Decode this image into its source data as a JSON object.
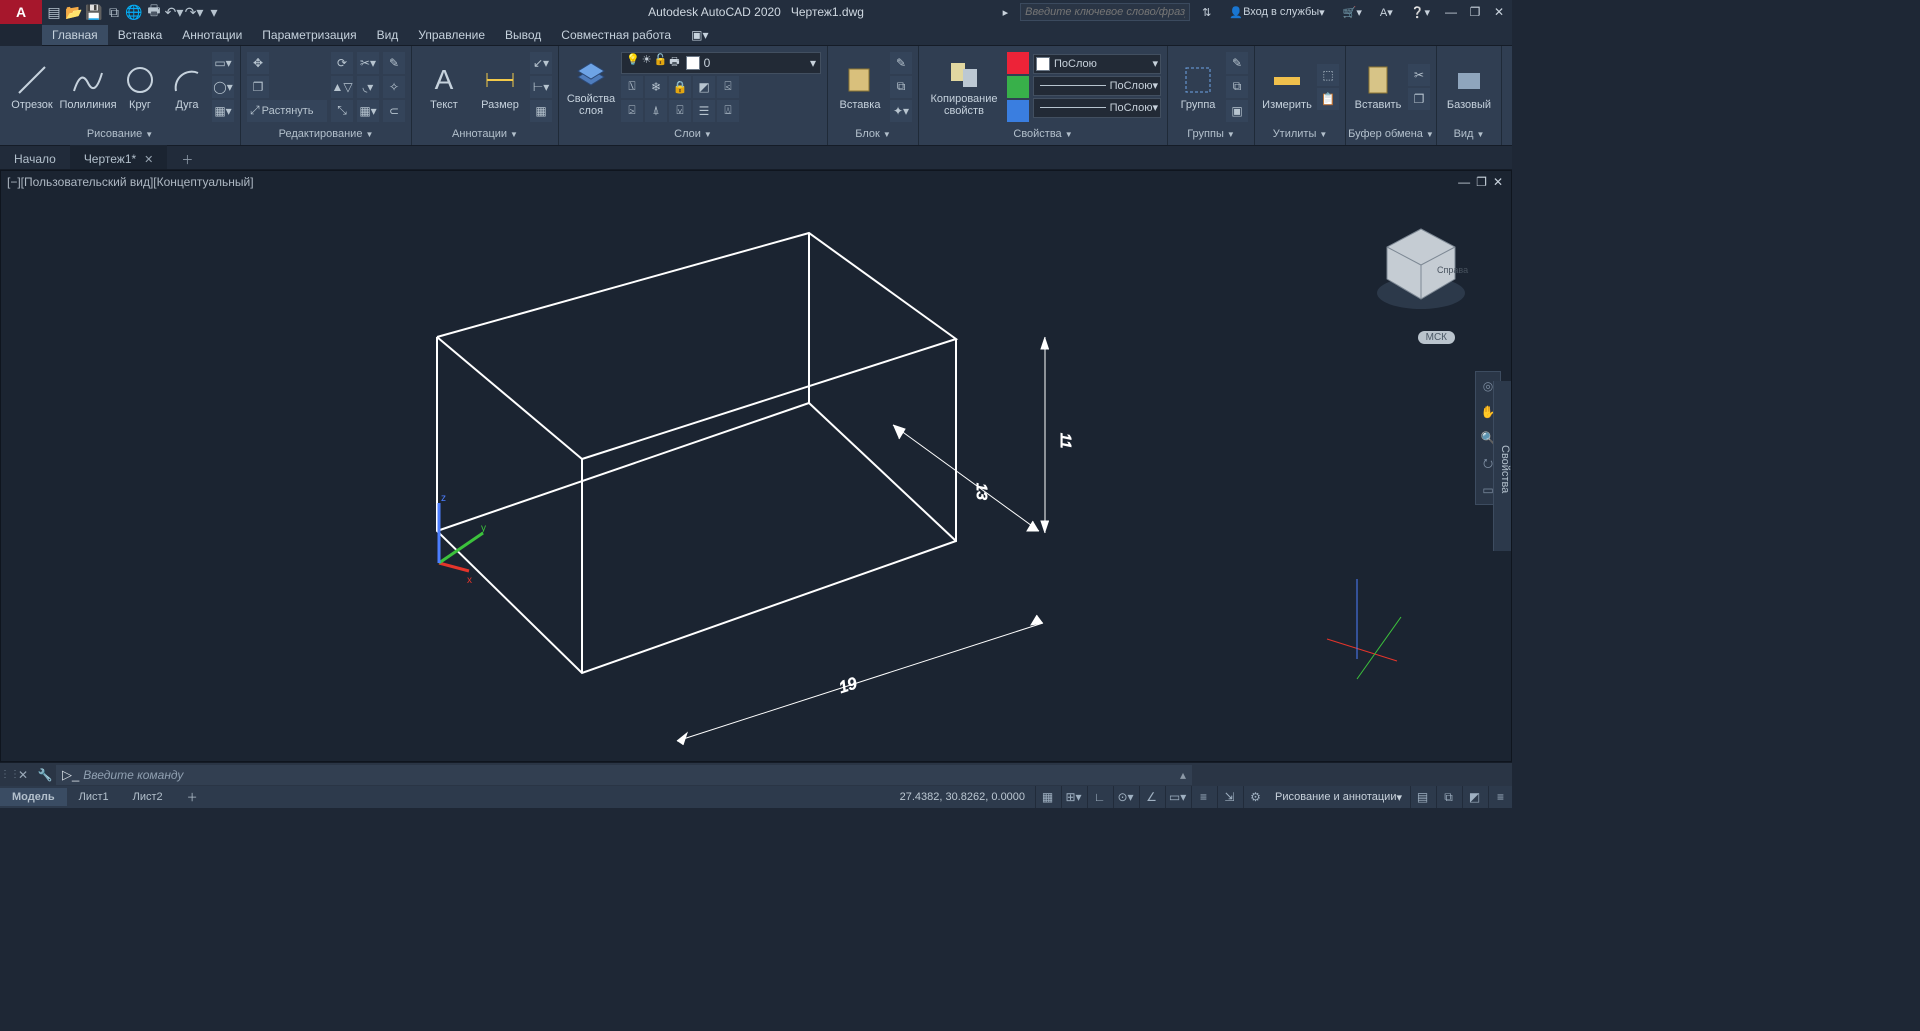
{
  "title": {
    "app": "Autodesk AutoCAD 2020",
    "file": "Чертеж1.dwg"
  },
  "search_placeholder": "Введите ключевое слово/фразу",
  "signin": "Вход в службы",
  "ribbon_tabs": [
    "Главная",
    "Вставка",
    "Аннотации",
    "Параметризация",
    "Вид",
    "Управление",
    "Вывод",
    "Совместная работа"
  ],
  "draw": {
    "line": "Отрезок",
    "pline": "Полилиния",
    "circle": "Круг",
    "arc": "Дуга",
    "title": "Рисование"
  },
  "mod": {
    "stretch": "Растянуть",
    "title": "Редактирование"
  },
  "annot": {
    "text": "Текст",
    "dim": "Размер",
    "title": "Аннотации"
  },
  "layers": {
    "props": "Свойства\nслоя",
    "current": "0",
    "title": "Слои"
  },
  "block": {
    "insert": "Вставка",
    "title": "Блок"
  },
  "props": {
    "match": "Копирование\nсвойств",
    "bylayer": "ПоСлою",
    "title": "Свойства"
  },
  "group": {
    "label": "Группа",
    "title": "Группы"
  },
  "util": {
    "measure": "Измерить",
    "title": "Утилиты"
  },
  "clip": {
    "paste": "Вставить",
    "title": "Буфер обмена"
  },
  "view": {
    "base": "Базовый",
    "title": "Вид"
  },
  "file_tabs": {
    "start": "Начало",
    "doc": "Чертеж1*"
  },
  "view_label": "[−][Пользовательский вид][Концептуальный]",
  "viewcube": {
    "right": "Справа",
    "wcs": "МСК"
  },
  "dims": {
    "w": "19",
    "d": "13",
    "h": "11"
  },
  "palette": "Свойства",
  "cmd_placeholder": "Введите команду",
  "layout_tabs": [
    "Модель",
    "Лист1",
    "Лист2"
  ],
  "coords": "27.4382, 30.8262, 0.0000",
  "workspace": "Рисование и аннотации"
}
